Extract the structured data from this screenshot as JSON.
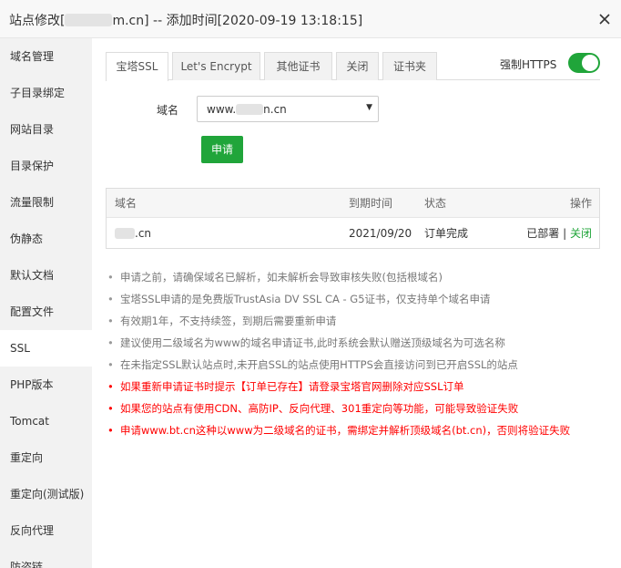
{
  "window": {
    "title_prefix": "站点修改[",
    "title_suffix": "m.cn] -- 添加时间[2020-09-19 13:18:15]"
  },
  "sidebar": {
    "items": [
      {
        "label": "域名管理"
      },
      {
        "label": "子目录绑定"
      },
      {
        "label": "网站目录"
      },
      {
        "label": "目录保护"
      },
      {
        "label": "流量限制"
      },
      {
        "label": "伪静态"
      },
      {
        "label": "默认文档"
      },
      {
        "label": "配置文件"
      },
      {
        "label": "SSL",
        "active": true
      },
      {
        "label": "PHP版本"
      },
      {
        "label": "Tomcat"
      },
      {
        "label": "重定向"
      },
      {
        "label": "重定向(测试版)"
      },
      {
        "label": "反向代理"
      },
      {
        "label": "防盗链"
      }
    ]
  },
  "ssl": {
    "tabs": [
      {
        "label": "宝塔SSL",
        "active": true
      },
      {
        "label": "Let's Encrypt"
      },
      {
        "label": "其他证书"
      },
      {
        "label": "关闭"
      },
      {
        "label": "证书夹"
      }
    ],
    "force_https_label": "强制HTTPS",
    "force_https_on": true,
    "domain_label": "域名",
    "domain_select_prefix": "www.",
    "domain_select_suffix": "n.cn",
    "apply_button": "申请",
    "table": {
      "headers": {
        "domain": "域名",
        "expire": "到期时间",
        "status": "状态",
        "action": "操作"
      },
      "rows": [
        {
          "domain_suffix": ".cn",
          "expire": "2021/09/20",
          "status": "订单完成",
          "deployed": "已部署",
          "separator": "|",
          "close": "关闭"
        }
      ]
    },
    "notes": [
      {
        "text": "申请之前，请确保域名已解析，如未解析会导致审核失败(包括根域名)",
        "red": false
      },
      {
        "text": "宝塔SSL申请的是免费版TrustAsia DV SSL CA - G5证书，仅支持单个域名申请",
        "red": false
      },
      {
        "text": "有效期1年，不支持续签，到期后需要重新申请",
        "red": false
      },
      {
        "text": "建议使用二级域名为www的域名申请证书,此时系统会默认赠送顶级域名为可选名称",
        "red": false
      },
      {
        "text": "在未指定SSL默认站点时,未开启SSL的站点使用HTTPS会直接访问到已开启SSL的站点",
        "red": false
      },
      {
        "text": "如果重新申请证书时提示【订单已存在】请登录宝塔官网删除对应SSL订单",
        "red": true
      },
      {
        "text": "如果您的站点有使用CDN、高防IP、反向代理、301重定向等功能，可能导致验证失败",
        "red": true
      },
      {
        "text": "申请www.bt.cn这种以www为二级域名的证书，需绑定并解析顶级域名(bt.cn)，否则将验证失败",
        "red": true
      }
    ]
  },
  "colors": {
    "accent": "#20a53a",
    "warning": "#ff0000",
    "sidebar_bg": "#f2f2f2"
  }
}
